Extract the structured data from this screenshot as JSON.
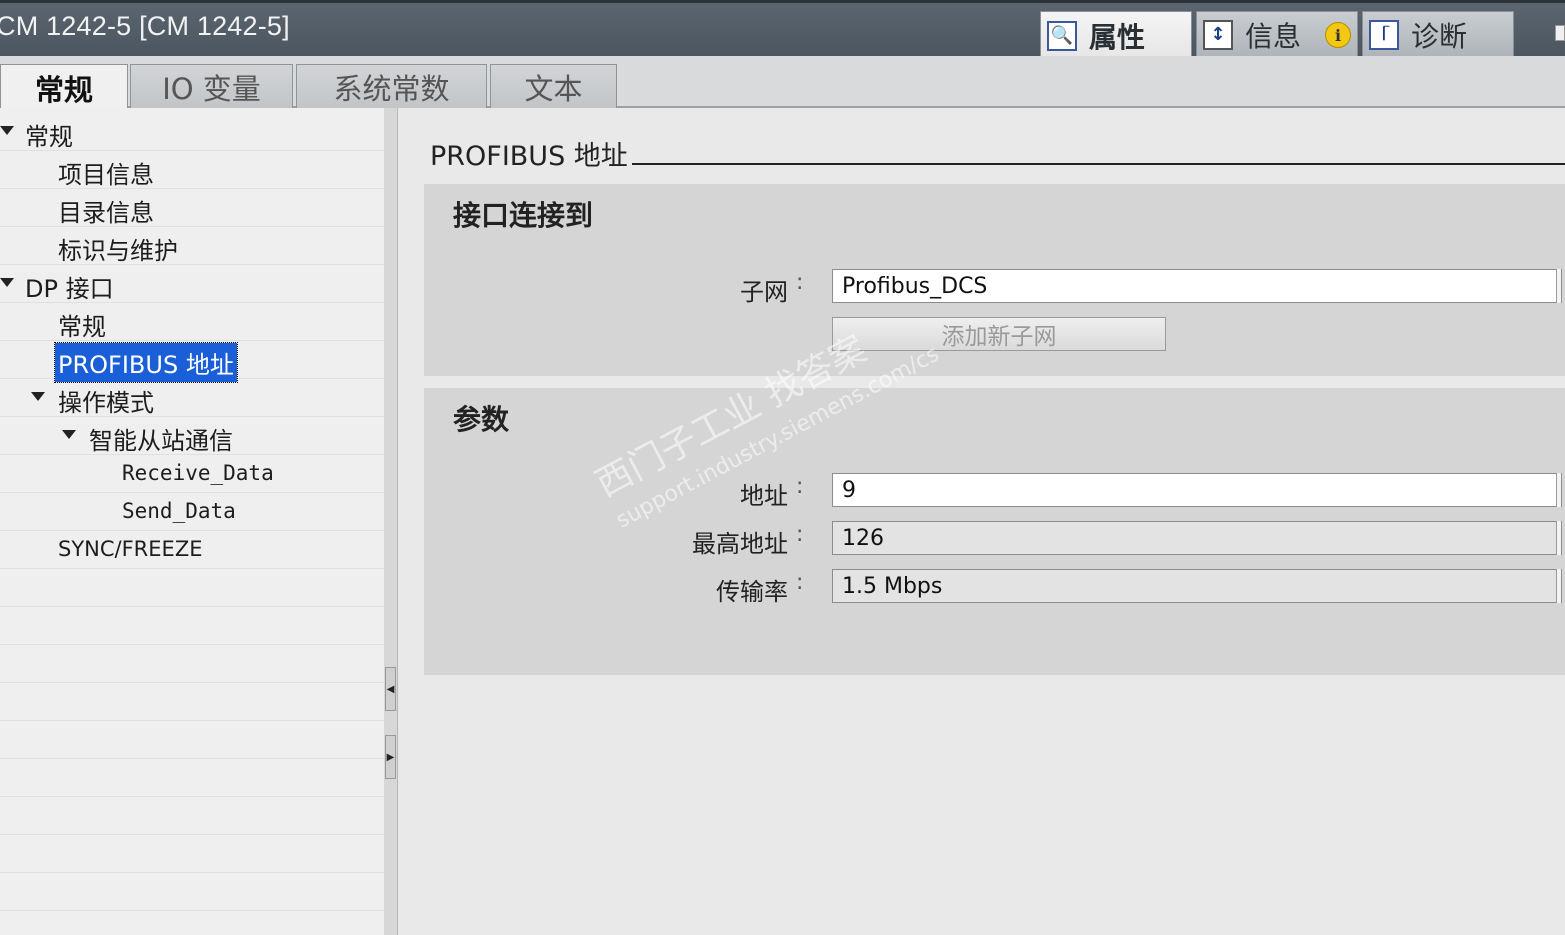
{
  "window": {
    "title": "CM 1242-5 [CM 1242-5]"
  },
  "right_tabs": [
    {
      "label": "属性",
      "icon": "properties-icon",
      "active": true
    },
    {
      "label": "信息",
      "icon": "info-icon",
      "badge": "i"
    },
    {
      "label": "诊断",
      "icon": "diagnostics-icon"
    }
  ],
  "sub_tabs": [
    {
      "label": "常规",
      "active": true
    },
    {
      "label": "IO 变量"
    },
    {
      "label": "系统常数"
    },
    {
      "label": "文本"
    }
  ],
  "nav": {
    "items": [
      {
        "label": "常规",
        "level": 0,
        "expanded": true
      },
      {
        "label": "项目信息",
        "level": 1
      },
      {
        "label": "目录信息",
        "level": 1
      },
      {
        "label": "标识与维护",
        "level": 1
      },
      {
        "label": "DP 接口",
        "level": 0,
        "expanded": true
      },
      {
        "label": "常规",
        "level": 1
      },
      {
        "label": "PROFIBUS 地址",
        "level": 1,
        "selected": true
      },
      {
        "label": "操作模式",
        "level": 1,
        "expanded": true
      },
      {
        "label": "智能从站通信",
        "level": 2,
        "expanded": true
      },
      {
        "label": "Receive_Data",
        "level": 3
      },
      {
        "label": "Send_Data",
        "level": 3
      },
      {
        "label": "SYNC/FREEZE",
        "level": 1
      }
    ]
  },
  "content": {
    "section_title": "PROFIBUS 地址",
    "interface_group": {
      "title": "接口连接到",
      "subnet_label": "子网",
      "subnet_value": "Profibus_DCS",
      "add_subnet_button": "添加新子网"
    },
    "params_group": {
      "title": "参数",
      "address_label": "地址",
      "address_value": "9",
      "max_address_label": "最高地址",
      "max_address_value": "126",
      "baud_label": "传输率",
      "baud_value": "1.5 Mbps"
    }
  },
  "watermark": {
    "line1": "西门子工业  找答案",
    "line2": "support.industry.siemens.com/cs"
  }
}
